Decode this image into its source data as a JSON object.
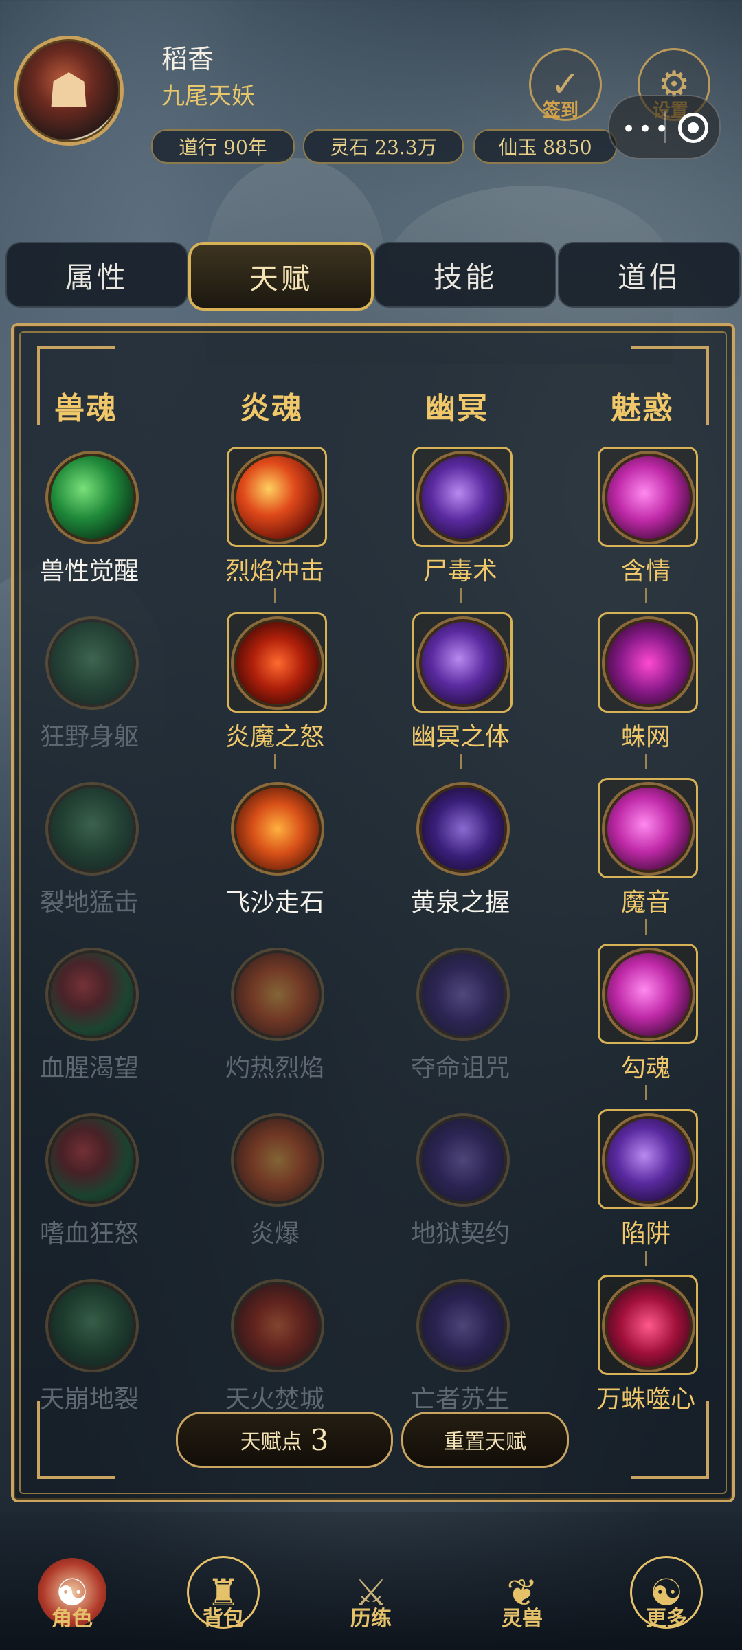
{
  "player": {
    "name": "稻香",
    "title": "九尾天妖",
    "stats": [
      {
        "label": "道行 90年"
      },
      {
        "label": "灵石 23.3万"
      },
      {
        "label": "仙玉 8850"
      }
    ]
  },
  "header_icons": {
    "checkin_label": "签到",
    "settings_label": "设置"
  },
  "tabs": [
    {
      "label": "属性",
      "active": false
    },
    {
      "label": "天赋",
      "active": true
    },
    {
      "label": "技能",
      "active": false
    },
    {
      "label": "道侣",
      "active": false
    }
  ],
  "talent_columns": [
    {
      "header": "兽魂",
      "nodes": [
        {
          "label": "兽性觉醒",
          "state": "lit"
        },
        {
          "label": "狂野身躯",
          "state": "dim"
        },
        {
          "label": "裂地猛击",
          "state": "dim"
        },
        {
          "label": "血腥渴望",
          "state": "dim"
        },
        {
          "label": "嗜血狂怒",
          "state": "dim"
        },
        {
          "label": "天崩地裂",
          "state": "dim"
        }
      ]
    },
    {
      "header": "炎魂",
      "nodes": [
        {
          "label": "烈焰冲击",
          "state": "active"
        },
        {
          "label": "炎魔之怒",
          "state": "active"
        },
        {
          "label": "飞沙走石",
          "state": "lit"
        },
        {
          "label": "灼热烈焰",
          "state": "dim"
        },
        {
          "label": "炎爆",
          "state": "dim"
        },
        {
          "label": "天火焚城",
          "state": "dim"
        }
      ]
    },
    {
      "header": "幽冥",
      "nodes": [
        {
          "label": "尸毒术",
          "state": "active"
        },
        {
          "label": "幽冥之体",
          "state": "active"
        },
        {
          "label": "黄泉之握",
          "state": "lit"
        },
        {
          "label": "夺命诅咒",
          "state": "dim"
        },
        {
          "label": "地狱契约",
          "state": "dim"
        },
        {
          "label": "亡者苏生",
          "state": "dim"
        }
      ]
    },
    {
      "header": "魅惑",
      "nodes": [
        {
          "label": "含情",
          "state": "active"
        },
        {
          "label": "蛛网",
          "state": "active"
        },
        {
          "label": "魔音",
          "state": "active"
        },
        {
          "label": "勾魂",
          "state": "active"
        },
        {
          "label": "陷阱",
          "state": "active"
        },
        {
          "label": "万蛛噬心",
          "state": "active"
        }
      ]
    }
  ],
  "talent_points": {
    "label": "天赋点",
    "value": "3"
  },
  "reset_label": "重置天赋",
  "bottom_nav": [
    {
      "label": "角色"
    },
    {
      "label": "背包"
    },
    {
      "label": "历练"
    },
    {
      "label": "灵兽"
    },
    {
      "label": "更多"
    }
  ]
}
